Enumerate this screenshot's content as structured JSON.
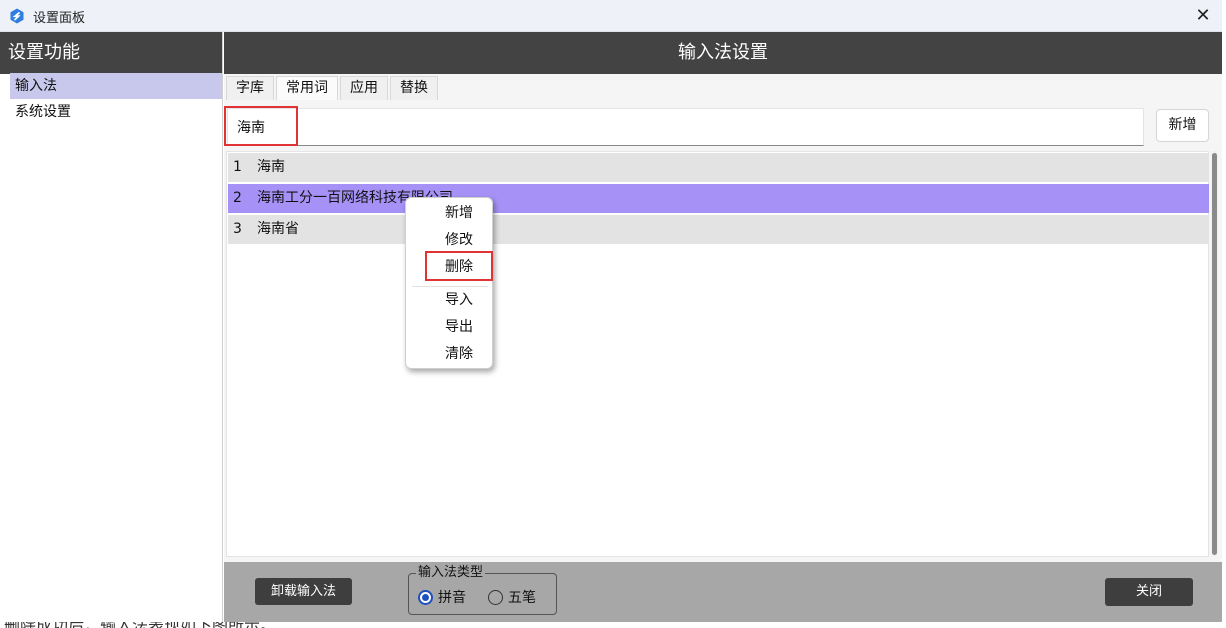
{
  "window": {
    "title": "设置面板",
    "close_glyph": "✕"
  },
  "sidebar": {
    "header": "设置功能",
    "items": [
      {
        "label": "输入法",
        "active": true
      },
      {
        "label": "系统设置",
        "active": false
      }
    ]
  },
  "main": {
    "header": "输入法设置",
    "tabs": [
      {
        "label": "字库",
        "active": false
      },
      {
        "label": "常用词",
        "active": true
      },
      {
        "label": "应用",
        "active": false
      },
      {
        "label": "替换",
        "active": false
      }
    ],
    "search_value": "海南",
    "add_button": "新增",
    "rows": [
      {
        "index": "1",
        "text": "海南",
        "selected": false
      },
      {
        "index": "2",
        "text": "海南工分一百网络科技有限公司",
        "selected": true
      },
      {
        "index": "3",
        "text": "海南省",
        "selected": false
      }
    ]
  },
  "context_menu": {
    "items": [
      "新增",
      "修改",
      "删除",
      "导入",
      "导出",
      "清除"
    ],
    "highlighted": "删除"
  },
  "bottom": {
    "uninstall_button": "卸载输入法",
    "ime_type_legend": "输入法类型",
    "radio_pinyin": "拼音",
    "radio_wubi": "五笔",
    "selected_type": "拼音",
    "close_button": "关闭"
  },
  "background_doc": {
    "text": "删除成功后，输入法表现如下图所示。"
  },
  "colors": {
    "header_bg": "#434343",
    "selected_row": "#a692f7",
    "sidebar_active": "#c8c8ec",
    "highlight_box": "#e03434",
    "bottom_bar": "#a7a7a7"
  }
}
